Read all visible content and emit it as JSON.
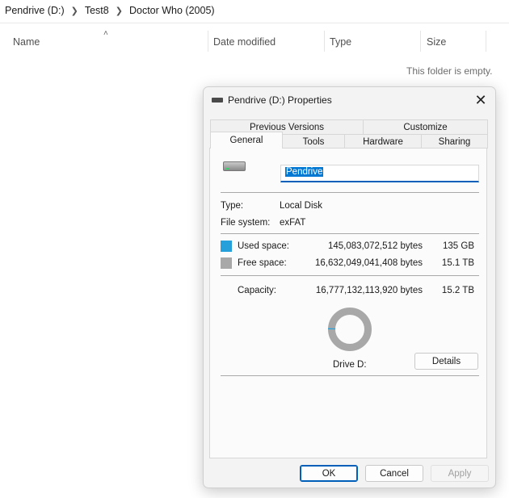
{
  "explorer": {
    "breadcrumb": [
      "Pendrive (D:)",
      "Test8",
      "Doctor Who (2005)"
    ],
    "columns": {
      "name": "Name",
      "date_modified": "Date modified",
      "type": "Type",
      "size": "Size"
    },
    "empty_message": "This folder is empty."
  },
  "dialog": {
    "title": "Pendrive (D:) Properties",
    "tabs_top": [
      "Previous Versions",
      "Customize"
    ],
    "tabs_bottom": [
      "General",
      "Tools",
      "Hardware",
      "Sharing"
    ],
    "active_tab": "General",
    "drive_name": "Pendrive",
    "type_label": "Type:",
    "type_value": "Local Disk",
    "fs_label": "File system:",
    "fs_value": "exFAT",
    "used_label": "Used space:",
    "used_bytes": "145,083,072,512 bytes",
    "used_short": "135 GB",
    "free_label": "Free space:",
    "free_bytes": "16,632,049,041,408 bytes",
    "free_short": "15.1 TB",
    "capacity_label": "Capacity:",
    "capacity_bytes": "16,777,132,113,920 bytes",
    "capacity_short": "15.2 TB",
    "used_fraction": 0.0086,
    "drive_label": "Drive D:",
    "details_button": "Details",
    "ok_button": "OK",
    "cancel_button": "Cancel",
    "apply_button": "Apply",
    "colors": {
      "used": "#26a0da",
      "free": "#a8a8a8",
      "accent": "#005fb8"
    }
  }
}
